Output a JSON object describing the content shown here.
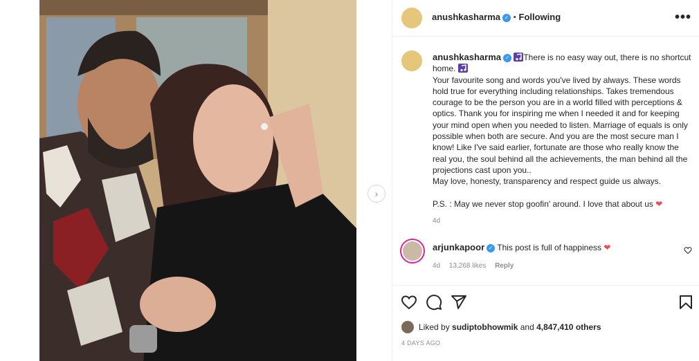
{
  "post": {
    "author": "anushkasharma",
    "follow_status": "Following",
    "separator": "•",
    "more_label": "•••",
    "next_label": "›"
  },
  "caption": {
    "username": "anushkasharma",
    "line1": "There is no easy way out, there is no shortcut home.",
    "body": "Your favourite song and words you've lived by always. These words hold true for everything including relationships. Takes tremendous courage to be the person you are in a world filled with perceptions & optics. Thank you for inspiring me when I needed it and for keeping your mind open when you needed to listen. Marriage of equals is only possible when both are secure. And you are the most secure man I know! Like I've said earlier, fortunate are those who really know the real you, the soul behind all the achievements, the man behind all the projections cast upon you..",
    "line_love": "May love, honesty, transparency and respect guide us always.",
    "ps": "P.S. : May we never stop goofin' around. I love that about us",
    "age": "4d"
  },
  "comment": {
    "username": "arjunkapoor",
    "text": "This post is full of happiness",
    "age": "4d",
    "likes": "13,268 likes",
    "reply_label": "Reply"
  },
  "likes": {
    "prefix": "Liked by",
    "user": "sudiptobhowmik",
    "and": "and",
    "others": "4,847,410 others"
  },
  "date": "4 DAYS AGO",
  "colors": {
    "verified": "#3897f0",
    "heart": "#ed4956",
    "muted": "#8e8e8e",
    "border": "#efefef"
  },
  "icons": [
    "verified-icon",
    "more-icon",
    "chevron-right-icon",
    "heart-icon",
    "comment-icon",
    "share-icon",
    "bookmark-icon",
    "music-emoji-icon",
    "red-heart-icon"
  ]
}
